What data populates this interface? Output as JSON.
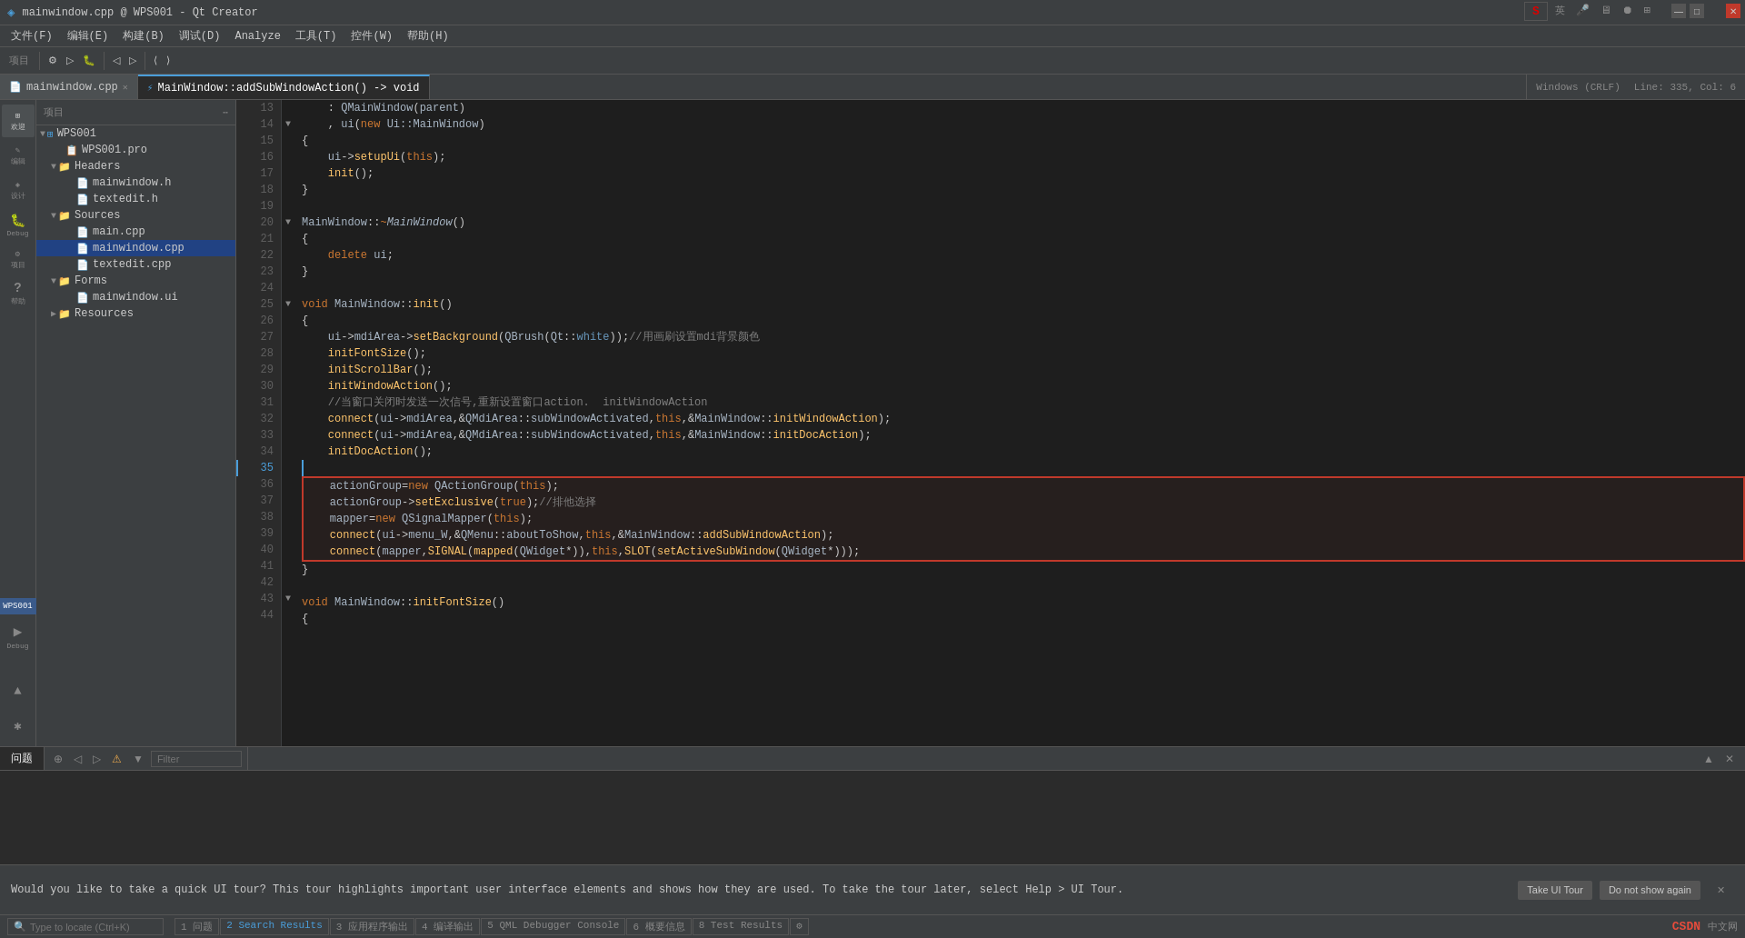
{
  "window": {
    "title": "mainwindow.cpp @ WPS001 - Qt Creator"
  },
  "titlebar": {
    "title": "mainwindow.cpp @ WPS001 - Qt Creator",
    "minimize": "—",
    "maximize": "□",
    "close": "✕"
  },
  "menubar": {
    "items": [
      "文件(F)",
      "编辑(E)",
      "构建(B)",
      "调试(D)",
      "Analyze",
      "工具(T)",
      "控件(W)",
      "帮助(H)"
    ]
  },
  "toolbar": {
    "project_label": "项目",
    "icons": [
      "≡",
      "◁",
      "▷",
      "↩",
      "↪",
      "⟨",
      "⟩"
    ]
  },
  "tabs": [
    {
      "label": "mainwindow.cpp",
      "active": true,
      "closable": true
    },
    {
      "label": "MainWindow::addSubWindowAction() -> void",
      "active": false,
      "closable": false
    }
  ],
  "statusbar_top": {
    "encoding": "Windows (CRLF)",
    "position": "Line: 335, Col: 6"
  },
  "filetree": {
    "title": "项目",
    "items": [
      {
        "level": 0,
        "name": "WPS001",
        "type": "project",
        "expanded": true
      },
      {
        "level": 1,
        "name": "WPS001.pro",
        "type": "file"
      },
      {
        "level": 1,
        "name": "Headers",
        "type": "folder",
        "expanded": true
      },
      {
        "level": 2,
        "name": "mainwindow.h",
        "type": "header"
      },
      {
        "level": 2,
        "name": "textedit.h",
        "type": "header"
      },
      {
        "level": 1,
        "name": "Sources",
        "type": "folder",
        "expanded": true
      },
      {
        "level": 2,
        "name": "main.cpp",
        "type": "source"
      },
      {
        "level": 2,
        "name": "mainwindow.cpp",
        "type": "source",
        "selected": true
      },
      {
        "level": 2,
        "name": "textedit.cpp",
        "type": "source"
      },
      {
        "level": 1,
        "name": "Forms",
        "type": "folder",
        "expanded": true
      },
      {
        "level": 2,
        "name": "mainwindow.ui",
        "type": "ui"
      },
      {
        "level": 1,
        "name": "Resources",
        "type": "folder",
        "expanded": false
      }
    ]
  },
  "sidebar_icons": [
    {
      "id": "welcome",
      "label": "欢迎",
      "icon": "⊞"
    },
    {
      "id": "edit",
      "label": "编辑",
      "icon": "✎",
      "active": true
    },
    {
      "id": "design",
      "label": "设计",
      "icon": "◈"
    },
    {
      "id": "debug",
      "label": "Debug",
      "icon": "🐛"
    },
    {
      "id": "projects",
      "label": "项目",
      "icon": "⚙"
    },
    {
      "id": "help",
      "label": "帮助",
      "icon": "?"
    },
    {
      "id": "debug2",
      "label": "Debug",
      "icon": "▶"
    }
  ],
  "code": {
    "lines": [
      {
        "num": 13,
        "content": "    : QMainWindow(parent)",
        "fold": false
      },
      {
        "num": 14,
        "content": "    , ui(new Ui::MainWindow)",
        "fold": true
      },
      {
        "num": 15,
        "content": "{",
        "fold": false
      },
      {
        "num": 16,
        "content": "    ui->setupUi(this);",
        "fold": false
      },
      {
        "num": 17,
        "content": "    init();",
        "fold": false
      },
      {
        "num": 18,
        "content": "}",
        "fold": false
      },
      {
        "num": 19,
        "content": "",
        "fold": false
      },
      {
        "num": 20,
        "content": "MainWindow::~MainWindow()",
        "fold": true,
        "italic_range": [
          13,
          25
        ]
      },
      {
        "num": 21,
        "content": "{",
        "fold": false
      },
      {
        "num": 22,
        "content": "    delete ui;",
        "fold": false
      },
      {
        "num": 23,
        "content": "}",
        "fold": false
      },
      {
        "num": 24,
        "content": "",
        "fold": false
      },
      {
        "num": 25,
        "content": "void MainWindow::init()",
        "fold": true
      },
      {
        "num": 26,
        "content": "{",
        "fold": false
      },
      {
        "num": 27,
        "content": "    ui->mdiArea->setBackground(QBrush(Qt::white));//用画刷设置mdi背景颜色",
        "fold": false
      },
      {
        "num": 28,
        "content": "    initFontSize();",
        "fold": false
      },
      {
        "num": 29,
        "content": "    initScrollBar();",
        "fold": false
      },
      {
        "num": 30,
        "content": "    initWindowAction();",
        "fold": false
      },
      {
        "num": 31,
        "content": "    //当窗口关闭时发送一次信号,重新设置窗口action.  initWindowAction",
        "fold": false
      },
      {
        "num": 32,
        "content": "    connect(ui->mdiArea,&QMdiArea::subWindowActivated,this,&MainWindow::initWindowAction);",
        "fold": false
      },
      {
        "num": 33,
        "content": "    connect(ui->mdiArea,&QMdiArea::subWindowActivated,this,&MainWindow::initDocAction);",
        "fold": false
      },
      {
        "num": 34,
        "content": "    initDocAction();",
        "fold": false
      },
      {
        "num": 35,
        "content": "",
        "fold": false
      },
      {
        "num": 36,
        "content": "    actionGroup=new QActionGroup(this);",
        "fold": false,
        "red_box_start": true
      },
      {
        "num": 37,
        "content": "    actionGroup->setExclusive(true);//排他选择",
        "fold": false
      },
      {
        "num": 38,
        "content": "    mapper=new QSignalMapper(this);",
        "fold": false
      },
      {
        "num": 39,
        "content": "    connect(ui->menu_W,&QMenu::aboutToShow,this,&MainWindow::addSubWindowAction);",
        "fold": false
      },
      {
        "num": 40,
        "content": "    connect(mapper,SIGNAL(mapped(QWidget*)),this,SLOT(setActiveSubWindow(QWidget*)));",
        "fold": false,
        "red_box_end": true
      },
      {
        "num": 41,
        "content": "}",
        "fold": false
      },
      {
        "num": 42,
        "content": "",
        "fold": false
      },
      {
        "num": 43,
        "content": "void MainWindow::initFontSize()",
        "fold": true
      },
      {
        "num": 44,
        "content": "{",
        "fold": false
      }
    ]
  },
  "bottom_panel": {
    "tabs": [
      "问题",
      "Search Results",
      "应用程序输出",
      "编译输出",
      "QML Debugger Console",
      "概要信息",
      "Test Results"
    ],
    "active_tab": "问题",
    "filter_placeholder": "Filter",
    "toolbar_icons": [
      "⚠",
      "▼"
    ]
  },
  "notification": {
    "text": "Would you like to take a quick UI tour? This tour highlights important user interface elements and shows how they are used. To take the tour later, select Help > UI Tour.",
    "btn_tour": "Take UI Tour",
    "btn_dismiss": "Do not show again",
    "close": "✕"
  },
  "statusbar_bottom": {
    "items": [
      "1 问题",
      "2 Search Results",
      "3 应用程序输出",
      "4 编译输出",
      "5 QML Debugger Console",
      "6 概要信息",
      "8 Test Results"
    ],
    "type_to_locate": "Type to locate (Ctrl+K)",
    "csdn_text": "CSDN中文网"
  }
}
